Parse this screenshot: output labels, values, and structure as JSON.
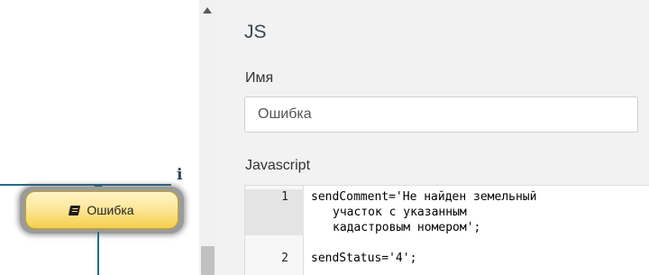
{
  "canvas": {
    "node": {
      "label": "Ошибка",
      "icon": "book-icon"
    },
    "info_icon_glyph": "i"
  },
  "panel": {
    "title": "JS",
    "name_field": {
      "label": "Имя",
      "value": "Ошибка"
    },
    "javascript_field": {
      "label": "Javascript",
      "lines": [
        {
          "number": "1",
          "parts": [
            "sendComment='Не найден земельный",
            "участок с указанным",
            "кадастровым номером';"
          ]
        },
        {
          "number": "2",
          "parts": [
            "sendStatus='4';"
          ]
        }
      ]
    }
  },
  "colors": {
    "connector": "#1f6f86",
    "node_fill": "#fde79b",
    "panel_bg": "#f2f2f2"
  }
}
